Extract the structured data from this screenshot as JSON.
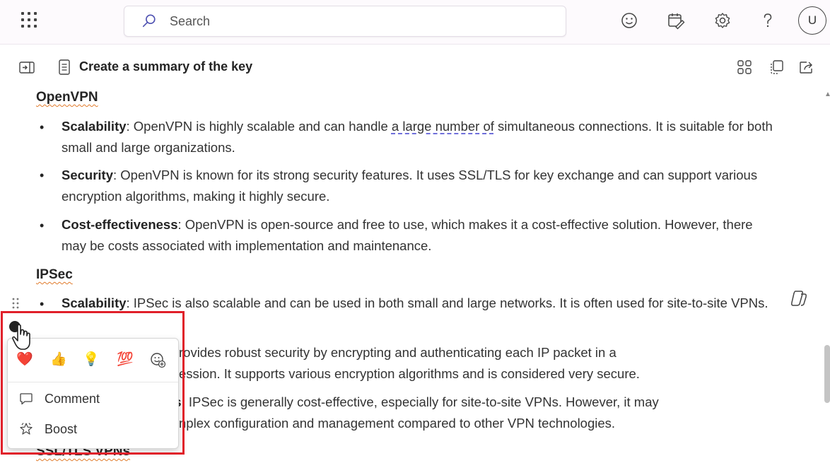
{
  "topbar": {
    "search_placeholder": "Search",
    "icons": [
      "waffle-icon",
      "search-icon",
      "emoji-icon",
      "calendar-edit-icon",
      "gear-icon",
      "help-icon"
    ],
    "avatar_initial": "U"
  },
  "doc": {
    "title": "Create a summary of the key"
  },
  "sections": [
    {
      "heading": "OpenVPN",
      "items": [
        {
          "term": "Scalability",
          "pre": ": OpenVPN is highly scalable and can handle ",
          "underlined": "a large number of",
          "post": " simultaneous connections. It is suitable for both small and large organizations."
        },
        {
          "term": "Security",
          "text": ": OpenVPN is known for its strong security features. It uses SSL/TLS for key exchange and can support various encryption algorithms, making it highly secure."
        },
        {
          "term": "Cost-effectiveness",
          "text": ": OpenVPN is open-source and free to use, which makes it a cost-effective solution. However, there may be costs associated with implementation and maintenance."
        }
      ]
    },
    {
      "heading": "IPSec",
      "items": [
        {
          "term": "Scalability",
          "text": ": IPSec is also scalable and can be used in both small and large networks. It is often used for site-to-site VPNs."
        },
        {
          "line1": "rovides robust security by encrypting and authenticating each IP packet in a",
          "line2": "ession. It supports various encryption algorithms and is considered very secure."
        },
        {
          "term_partial": "ss",
          "line1": ": IPSec is generally cost-effective, especially for site-to-site VPNs. However, it may",
          "line2": "nplex configuration and management compared to other VPN technologies."
        }
      ]
    },
    {
      "heading_partial": "SSL/TLS VPNs"
    }
  ],
  "popup": {
    "reactions": [
      "❤️",
      "👍",
      "💡",
      "💯",
      "add-reaction"
    ],
    "menu": [
      {
        "label": "Comment",
        "icon": "comment-icon"
      },
      {
        "label": "Boost",
        "icon": "boost-icon"
      }
    ]
  }
}
